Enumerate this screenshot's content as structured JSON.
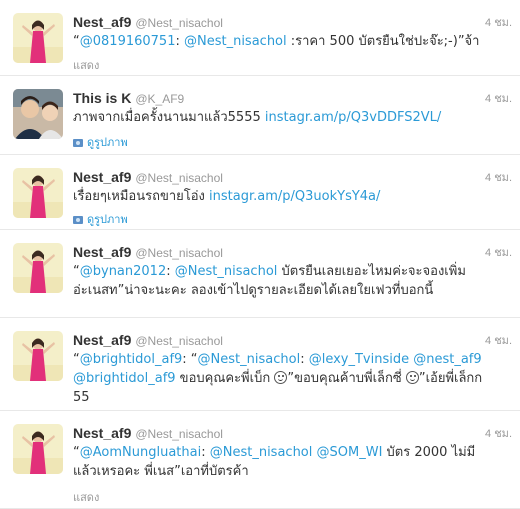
{
  "tweets": [
    {
      "name": "Nest_af9",
      "handle": "@Nest_nisachol",
      "time": "4 ชม.",
      "avatar": "nest-pink-dress",
      "parts": [
        {
          "t": "“",
          "link": false
        },
        {
          "t": "@0819160751",
          "link": true
        },
        {
          "t": ": ",
          "link": false
        },
        {
          "t": "@Nest_nisachol",
          "link": true
        },
        {
          "t": " :ราคา 500 บัตรยืนใช่ปะจ๊ะ;-)”จ้า",
          "link": false
        }
      ],
      "action": "แสดง",
      "action_type": "text"
    },
    {
      "name": "This is K",
      "handle": "@K_AF9",
      "time": "4 ชม.",
      "avatar": "this-is-k",
      "parts": [
        {
          "t": "ภาพจากเมื่อครั้งนานมาแล้ว5555 ",
          "link": false
        },
        {
          "t": "instagr.am/p/Q3vDDFS2VL/",
          "link": true
        }
      ],
      "action": "ดูรูปภาพ",
      "action_type": "photo"
    },
    {
      "name": "Nest_af9",
      "handle": "@Nest_nisachol",
      "time": "4 ชม.",
      "avatar": "nest-pink-dress",
      "parts": [
        {
          "t": "เรื่อยๆเหมือนรถขายโอ่ง ",
          "link": false
        },
        {
          "t": "instagr.am/p/Q3uokYsY4a/",
          "link": true
        }
      ],
      "action": "ดูรูปภาพ",
      "action_type": "photo"
    },
    {
      "name": "Nest_af9",
      "handle": "@Nest_nisachol",
      "time": "4 ชม.",
      "avatar": "nest-pink-dress",
      "parts": [
        {
          "t": "“",
          "link": false
        },
        {
          "t": "@bynan2012",
          "link": true
        },
        {
          "t": ": ",
          "link": false
        },
        {
          "t": "@Nest_nisachol",
          "link": true
        },
        {
          "t": " บัตรยืนเลยเยอะไหมค่ะจะจองเพิ่มอ่ะเนสท”น่าจะนะคะ ลองเข้าไปดูรายละเอียดได้เลยใยเฟวที่บอกนี้",
          "link": false
        }
      ],
      "action": "",
      "action_type": "none"
    },
    {
      "name": "Nest_af9",
      "handle": "@Nest_nisachol",
      "time": "4 ชม.",
      "avatar": "nest-pink-dress",
      "parts": [
        {
          "t": "“",
          "link": false
        },
        {
          "t": "@brightidol_af9",
          "link": true
        },
        {
          "t": ": “",
          "link": false
        },
        {
          "t": "@Nest_nisachol",
          "link": true
        },
        {
          "t": ": ",
          "link": false
        },
        {
          "t": "@lexy_Tvinside",
          "link": true
        },
        {
          "t": " ",
          "link": false
        },
        {
          "t": "@nest_af9",
          "link": true
        },
        {
          "t": " ",
          "link": false
        },
        {
          "t": "@brightidol_af9",
          "link": true
        },
        {
          "t": " ขอบคุณคะพี่เบ็ก ",
          "link": false
        },
        {
          "emoji": true
        },
        {
          "t": "”ขอบคุณค้าบพี่เล็กซี่ ",
          "link": false
        },
        {
          "emoji": true
        },
        {
          "t": "”เอ้ยพี่เล็กก 55",
          "link": false
        }
      ],
      "action": "",
      "action_type": "none"
    },
    {
      "name": "Nest_af9",
      "handle": "@Nest_nisachol",
      "time": "4 ชม.",
      "avatar": "nest-pink-dress",
      "parts": [
        {
          "t": "“",
          "link": false
        },
        {
          "t": "@AomNungluathai",
          "link": true
        },
        {
          "t": ": ",
          "link": false
        },
        {
          "t": "@Nest_nisachol",
          "link": true
        },
        {
          "t": " ",
          "link": false
        },
        {
          "t": "@SOM_WI",
          "link": true
        },
        {
          "t": " บัตร 2000 ไม่มีแล้วเหรอคะ พี่เนส”เอาที่บัตรค้า",
          "link": false
        }
      ],
      "action": "แสดง",
      "action_type": "text"
    }
  ],
  "colors": {
    "link": "#2b9ad6",
    "name": "#333333",
    "meta": "#999999",
    "divider": "#e8e8e8"
  }
}
